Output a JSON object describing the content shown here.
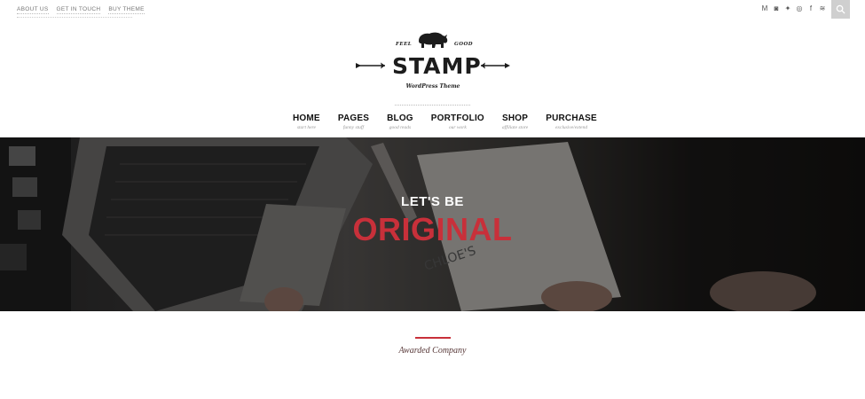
{
  "top_links": [
    "ABOUT US",
    "GET IN TOUCH",
    "BUY THEME"
  ],
  "social_icons": [
    "medium-icon",
    "instagram-icon",
    "twitter-icon",
    "dribbble-icon",
    "facebook-icon",
    "rss-icon"
  ],
  "social_glyphs": [
    "M",
    "◙",
    "✦",
    "◎",
    "f",
    "≋"
  ],
  "logo": {
    "feel": "FEEL",
    "good": "GOOD",
    "name": "STAMP",
    "tagline": "WordPress Theme"
  },
  "nav": [
    {
      "label": "HOME",
      "sub": "start here"
    },
    {
      "label": "PAGES",
      "sub": "funny stuff"
    },
    {
      "label": "BLOG",
      "sub": "good reads"
    },
    {
      "label": "PORTFOLIO",
      "sub": "our work"
    },
    {
      "label": "SHOP",
      "sub": "affiliate store"
    },
    {
      "label": "PURCHASE",
      "sub": "exclusive/extend"
    }
  ],
  "hero": {
    "line1": "LET'S BE",
    "line2": "ORIGINAL"
  },
  "section": {
    "title": "Awarded Company"
  },
  "colors": {
    "accent": "#c8303a",
    "text": "#111111"
  }
}
